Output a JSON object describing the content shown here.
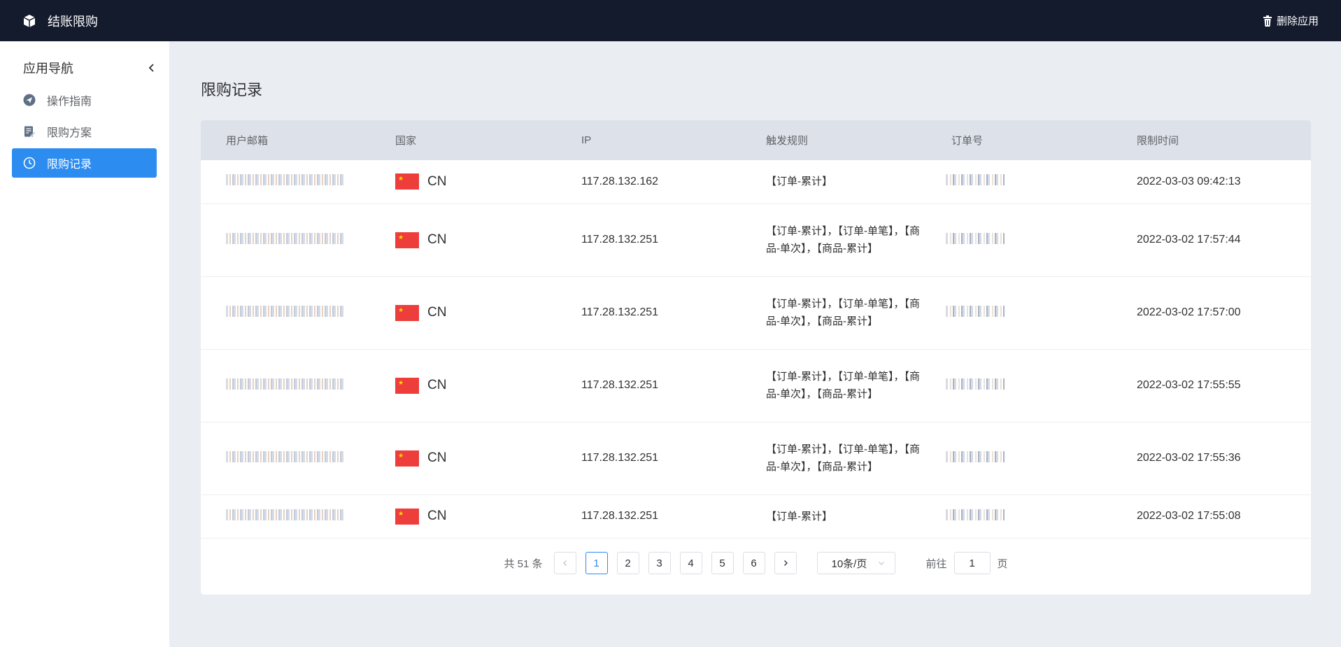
{
  "header": {
    "app_title": "结账限购",
    "delete_label": "删除应用"
  },
  "sidebar": {
    "title": "应用导航",
    "items": [
      {
        "label": "操作指南",
        "icon": "send-icon"
      },
      {
        "label": "限购方案",
        "icon": "edit-doc-icon"
      },
      {
        "label": "限购记录",
        "icon": "clock-icon",
        "active": true
      }
    ]
  },
  "page": {
    "title": "限购记录"
  },
  "table": {
    "columns": [
      "用户邮箱",
      "国家",
      "IP",
      "触发规则",
      "订单号",
      "限制时间"
    ],
    "rows": [
      {
        "country": "CN",
        "ip": "117.28.132.162",
        "rule": "【订单-累计】",
        "time": "2022-03-03 09:42:13"
      },
      {
        "country": "CN",
        "ip": "117.28.132.251",
        "rule": "【订单-累计】，【订单-单笔】，【商品-单次】，【商品-累计】",
        "time": "2022-03-02 17:57:44"
      },
      {
        "country": "CN",
        "ip": "117.28.132.251",
        "rule": "【订单-累计】，【订单-单笔】，【商品-单次】，【商品-累计】",
        "time": "2022-03-02 17:57:00"
      },
      {
        "country": "CN",
        "ip": "117.28.132.251",
        "rule": "【订单-累计】，【订单-单笔】，【商品-单次】，【商品-累计】",
        "time": "2022-03-02 17:55:55"
      },
      {
        "country": "CN",
        "ip": "117.28.132.251",
        "rule": "【订单-累计】，【订单-单笔】，【商品-单次】，【商品-累计】",
        "time": "2022-03-02 17:55:36"
      },
      {
        "country": "CN",
        "ip": "117.28.132.251",
        "rule": "【订单-累计】",
        "time": "2022-03-02 17:55:08"
      }
    ]
  },
  "pagination": {
    "total_label": "共 51 条",
    "pages": [
      "1",
      "2",
      "3",
      "4",
      "5",
      "6"
    ],
    "current": "1",
    "page_size": "10条/页",
    "goto_prefix": "前往",
    "goto_value": "1",
    "goto_suffix": "页"
  },
  "colors": {
    "topbar": "#141b2d",
    "accent": "#2d8cf0",
    "background": "#eaedf2",
    "table_header": "#dde2ea"
  }
}
